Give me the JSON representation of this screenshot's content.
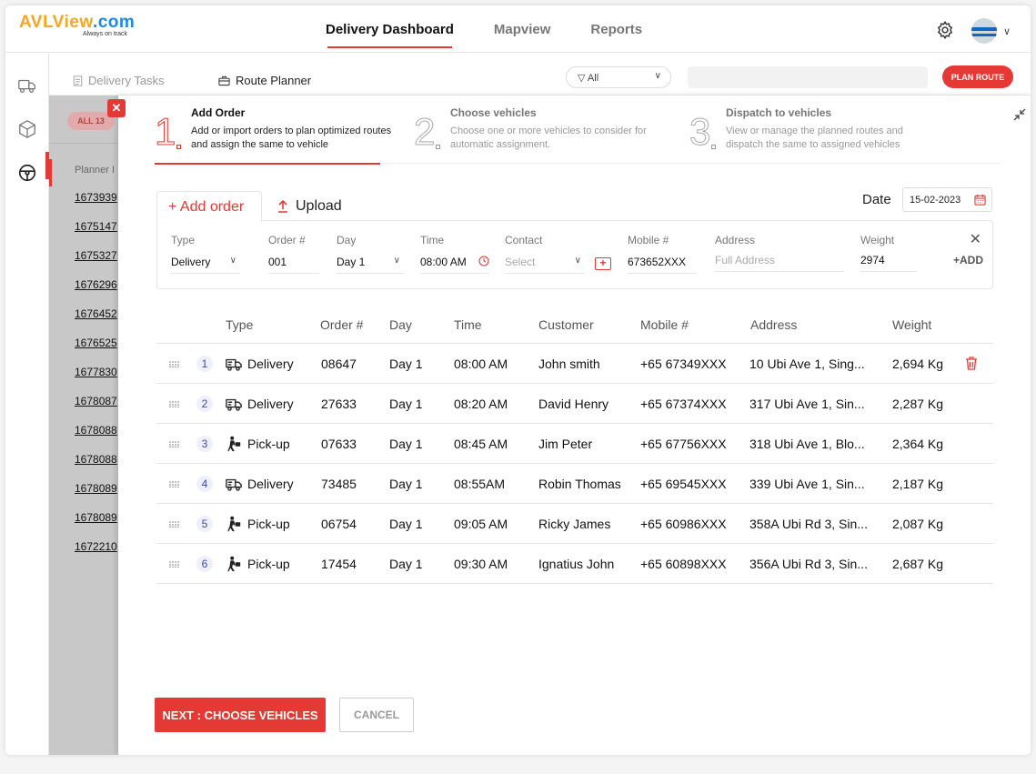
{
  "brand": {
    "logo_main": "AVLView",
    "logo_tld": ".com",
    "tagline": "Always on track"
  },
  "header": {
    "nav": [
      {
        "label": "Delivery Dashboard",
        "active": true
      },
      {
        "label": "Mapview",
        "active": false
      },
      {
        "label": "Reports",
        "active": false
      }
    ],
    "settings_icon": "gear-icon",
    "avatar_icon": "avatar"
  },
  "subnav": {
    "tabs": [
      {
        "label": "Delivery Tasks",
        "icon": "document-icon",
        "active": false
      },
      {
        "label": "Route Planner",
        "icon": "briefcase-icon",
        "active": true
      }
    ],
    "filter_value": "All",
    "search_placeholder": "",
    "plan_route_label": "PLAN ROUTE"
  },
  "background": {
    "all_chip": "ALL 13",
    "planner_header": "Planner I",
    "planner_ids": [
      "1673939",
      "1675147",
      "1675327",
      "1676296",
      "1676452",
      "1676525",
      "1677830",
      "1678087",
      "1678088",
      "1678088",
      "1678089",
      "1678089",
      "1672210"
    ]
  },
  "steps": [
    {
      "num": "1",
      "title": "Add Order",
      "desc": "Add or import orders to plan optimized routes and assign the same to vehicle",
      "active": true
    },
    {
      "num": "2",
      "title": "Choose vehicles",
      "desc": "Choose one or more vehicles to consider for automatic assignment.",
      "active": false
    },
    {
      "num": "3",
      "title": "Dispatch to vehicles",
      "desc": "View or manage the planned routes and dispatch the same to assigned vehicles",
      "active": false
    }
  ],
  "entry": {
    "add_order_tab": "+ Add order",
    "upload_tab": "Upload",
    "date_label": "Date",
    "date_value": "15-02-2023",
    "fields": {
      "type": {
        "label": "Type",
        "value": "Delivery"
      },
      "order": {
        "label": "Order #",
        "value": "001"
      },
      "day": {
        "label": "Day",
        "value": "Day 1"
      },
      "time": {
        "label": "Time",
        "value": "08:00 AM"
      },
      "contact": {
        "label": "Contact",
        "placeholder": "Select"
      },
      "mobile": {
        "label": "Mobile #",
        "value": "673652XXX"
      },
      "address": {
        "label": "Address",
        "placeholder": "Full Address"
      },
      "weight": {
        "label": "Weight",
        "value": "2974"
      }
    },
    "close_label": "✕",
    "add_label": "+ADD"
  },
  "table": {
    "headers": {
      "type": "Type",
      "order": "Order #",
      "day": "Day",
      "time": "Time",
      "customer": "Customer",
      "mobile": "Mobile #",
      "address": "Address",
      "weight": "Weight"
    },
    "rows": [
      {
        "num": "1",
        "type": "Delivery",
        "icon": "truck-icon",
        "order": "08647",
        "day": "Day 1",
        "time": "08:00 AM",
        "customer": "John smith",
        "mobile": "+65 67349XXX",
        "address": "10 Ubi Ave 1, Sing...",
        "weight": "2,694 Kg"
      },
      {
        "num": "2",
        "type": "Delivery",
        "icon": "truck-icon",
        "order": "27633",
        "day": "Day 1",
        "time": "08:20 AM",
        "customer": "David Henry",
        "mobile": "+65 67374XXX",
        "address": "317 Ubi Ave 1, Sin...",
        "weight": "2,287 Kg"
      },
      {
        "num": "3",
        "type": "Pick-up",
        "icon": "person-carry-icon",
        "order": "07633",
        "day": "Day 1",
        "time": "08:45 AM",
        "customer": "Jim Peter",
        "mobile": "+65 67756XXX",
        "address": "318 Ubi Ave 1, Blo...",
        "weight": "2,364 Kg"
      },
      {
        "num": "4",
        "type": "Delivery",
        "icon": "truck-icon",
        "order": "73485",
        "day": "Day 1",
        "time": "08:55AM",
        "customer": "Robin  Thomas",
        "mobile": "+65 69545XXX",
        "address": "339 Ubi Ave 1, Sin...",
        "weight": "2,187 Kg"
      },
      {
        "num": "5",
        "type": "Pick-up",
        "icon": "person-carry-icon",
        "order": "06754",
        "day": "Day 1",
        "time": "09:05 AM",
        "customer": "Ricky James",
        "mobile": "+65 60986XXX",
        "address": "358A Ubi Rd 3, Sin...",
        "weight": "2,087 Kg"
      },
      {
        "num": "6",
        "type": "Pick-up",
        "icon": "person-carry-icon",
        "order": "17454",
        "day": "Day 1",
        "time": "09:30 AM",
        "customer": "Ignatius John",
        "mobile": "+65 60898XXX",
        "address": "356A Ubi Rd 3, Sin...",
        "weight": "2,687 Kg"
      }
    ]
  },
  "footer": {
    "next_label": "NEXT : CHOOSE VEHICLES",
    "cancel_label": "CANCEL"
  },
  "colors": {
    "accent": "#e53935",
    "logo_orange": "#f5a623",
    "logo_blue": "#1e88e5"
  }
}
